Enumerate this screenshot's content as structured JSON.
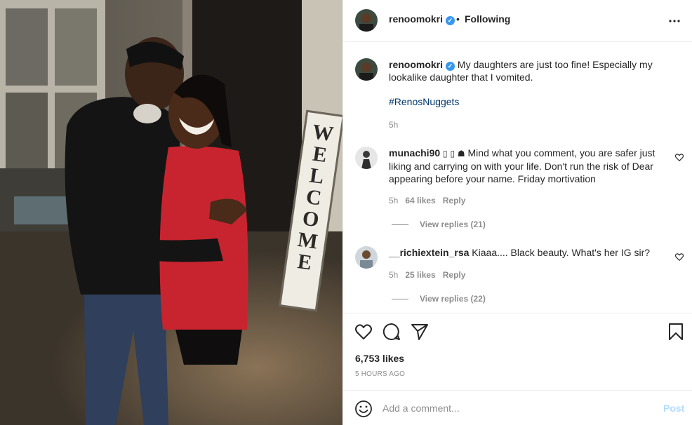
{
  "post": {
    "username": "renoomokri",
    "verified_mark": "✓",
    "separator": "•",
    "follow_status": "Following",
    "caption_text": "My daughters are just too fine! Especially my lookalike daughter that I vomited.",
    "hashtag": "#RenosNuggets",
    "caption_time": "5h",
    "likes": "6,753 likes",
    "posted_ago": "5 HOURS AGO",
    "photo_sign_text": "WELCOME"
  },
  "comments": [
    {
      "username": "munachi90",
      "text": " Mind what you comment, you are safer just liking and carrying on with your life. Don't run the risk of Dear appearing before your name. Friday mortivation",
      "emoji_glyphs": "▯ ▯ ☗",
      "time": "5h",
      "likes": "64 likes",
      "reply_label": "Reply",
      "view_replies": "View replies (21)"
    },
    {
      "username": "__richiextein_rsa",
      "text": "Kiaaa.... Black beauty. What's her IG sir?",
      "time": "5h",
      "likes": "25 likes",
      "reply_label": "Reply",
      "view_replies": "View replies (22)"
    }
  ],
  "add_comment": {
    "placeholder": "Add a comment...",
    "post_label": "Post"
  },
  "icons": {
    "more": "more-options-icon",
    "heart": "heart-icon",
    "comment": "comment-icon",
    "share": "share-icon",
    "save": "bookmark-icon",
    "emoji": "emoji-icon"
  },
  "colors": {
    "link": "#00376b",
    "verified": "#3897f0",
    "muted": "#8e8e8e",
    "post_button_disabled": "#b3dbff"
  }
}
